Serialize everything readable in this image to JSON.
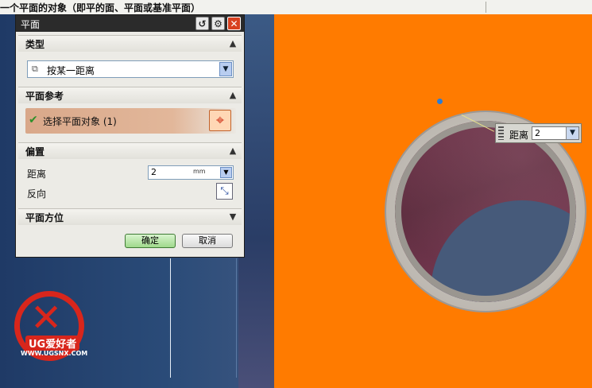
{
  "hint_bar": {
    "text": "一个平面的对象（即平的面、平面或基准平面）"
  },
  "dialog": {
    "title": "平面",
    "title_buttons": {
      "reset_icon": "reset-icon",
      "settings_icon": "gear-icon",
      "close_icon": "close-icon"
    },
    "sections": {
      "type": {
        "header": "类型",
        "combo_value": "按某一距离",
        "combo_icon": "plane-distance-icon"
      },
      "reference": {
        "header": "平面参考",
        "select_label": "选择平面对象 (1)",
        "select_status_icon": "check-icon",
        "picker_icon": "crosshair-icon"
      },
      "offset": {
        "header": "偏置",
        "distance_label": "距离",
        "distance_value": "2",
        "distance_unit": "mm",
        "reverse_label": "反向",
        "reverse_icon": "reverse-direction-icon"
      },
      "orientation": {
        "header": "平面方位"
      }
    },
    "ok_label": "确定",
    "cancel_label": "取消"
  },
  "viewport": {
    "distance_callout": {
      "label": "距离",
      "value": "2"
    }
  },
  "watermark": {
    "brand": "UG爱好者",
    "url": "WWW.UGSNX.COM"
  }
}
